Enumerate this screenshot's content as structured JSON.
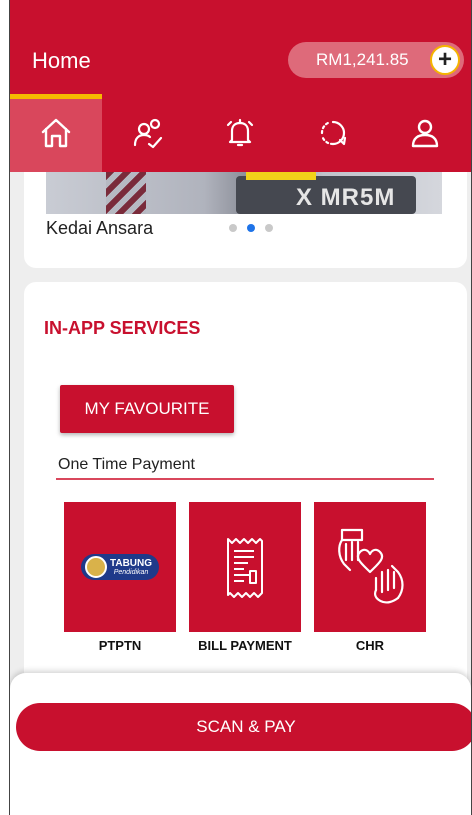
{
  "header": {
    "title": "Home",
    "balance": "RM1,241.85",
    "add_symbol": "+"
  },
  "nav": {
    "tabs": [
      "home",
      "contacts",
      "notifications",
      "history",
      "profile"
    ],
    "active": "home"
  },
  "banner": {
    "plate_text": "X MR5M",
    "caption": "Kedai Ansara",
    "slide_count": 3,
    "active_slide": 2
  },
  "services": {
    "title": "IN-APP SERVICES",
    "favourite_label": "MY FAVOURITE",
    "one_time_label": "One Time Payment",
    "tiles": [
      {
        "label": "PTPTN",
        "icon": "tabung-pendidikan-logo",
        "logo_text": "TABUNG",
        "logo_sub": "Pendidikan"
      },
      {
        "label": "BILL PAYMENT",
        "icon": "receipt-icon"
      },
      {
        "label": "CHR",
        "icon": "heart-hands-icon"
      }
    ]
  },
  "bottom": {
    "scan_label": "SCAN & PAY"
  },
  "colors": {
    "brand": "#c8102e",
    "accent": "#f6b900",
    "dot_active": "#1e73e8"
  }
}
